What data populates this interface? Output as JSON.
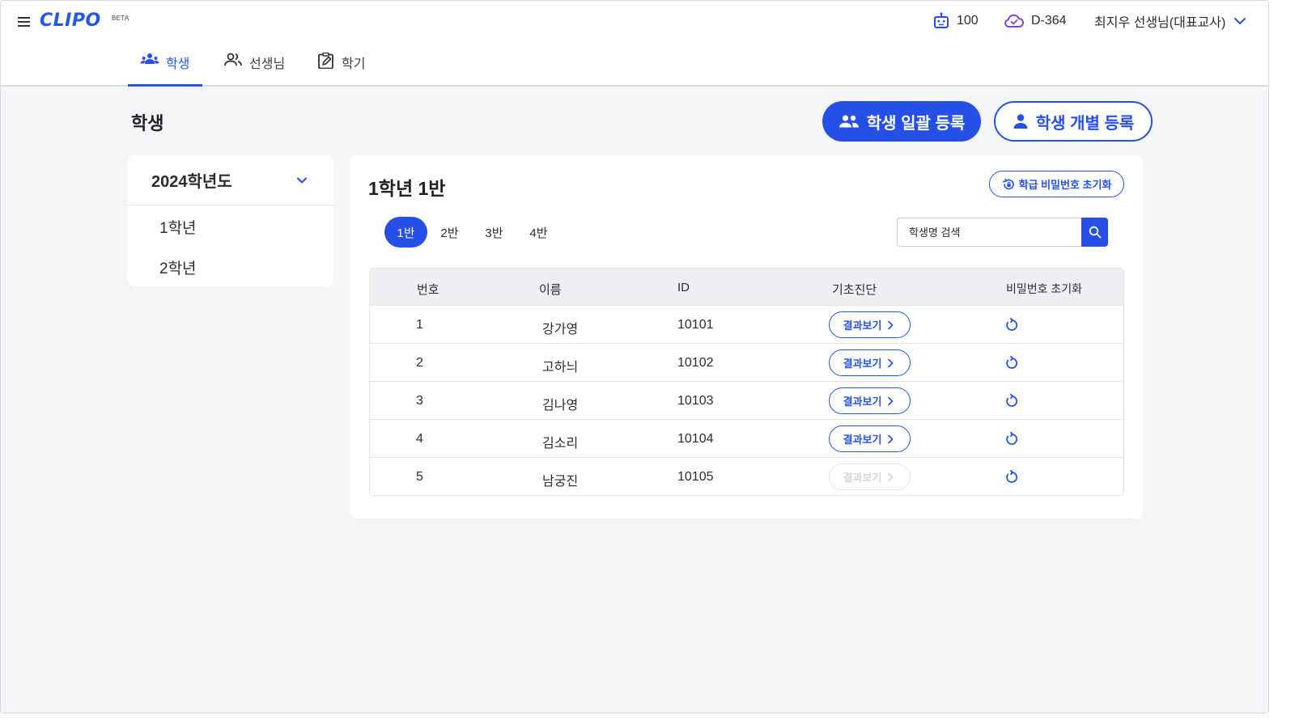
{
  "header": {
    "logo": "CLIPO",
    "logo_badge": "BETA",
    "credits": "100",
    "dday": "D-364",
    "user": "최지우 선생님(대표교사)"
  },
  "tabs": [
    {
      "label": "학생",
      "active": true
    },
    {
      "label": "선생님",
      "active": false
    },
    {
      "label": "학기",
      "active": false
    }
  ],
  "page": {
    "title": "학생",
    "bulk_button": "학생 일괄 등록",
    "single_button": "학생 개별 등록"
  },
  "sidebar": {
    "year": "2024학년도",
    "grades": [
      "1학년",
      "2학년"
    ]
  },
  "panel": {
    "title": "1학년 1반",
    "reset_button": "학급 비밀번호 초기화",
    "class_tabs": [
      {
        "label": "1반",
        "active": true
      },
      {
        "label": "2반",
        "active": false
      },
      {
        "label": "3반",
        "active": false
      },
      {
        "label": "4반",
        "active": false
      }
    ],
    "search_placeholder": "학생명 검색"
  },
  "table": {
    "columns": [
      "번호",
      "이름",
      "ID",
      "기초진단",
      "비밀번호 초기화"
    ],
    "result_label": "결과보기",
    "rows": [
      {
        "no": "1",
        "name": "강가영",
        "id": "10101",
        "result_enabled": true
      },
      {
        "no": "2",
        "name": "고하늬",
        "id": "10102",
        "result_enabled": true
      },
      {
        "no": "3",
        "name": "김나영",
        "id": "10103",
        "result_enabled": true
      },
      {
        "no": "4",
        "name": "김소리",
        "id": "10104",
        "result_enabled": true
      },
      {
        "no": "5",
        "name": "남궁진",
        "id": "10105",
        "result_enabled": false
      }
    ]
  },
  "colors": {
    "accent": "#2550e8",
    "background": "#f4f5f7",
    "disabled": "#d3d6dc"
  },
  "icons": {
    "menu": "hamburger-icon",
    "credits": "robot-icon",
    "dday": "cloud-icon",
    "user_menu": "chevron-down-icon",
    "tab_students": "students-icon",
    "tab_teachers": "teachers-icon",
    "tab_semester": "clipboard-edit-icon",
    "bulk": "group-icon",
    "single": "person-icon",
    "reset_class": "lock-reset-icon",
    "search": "search-icon",
    "result_arrow": "chevron-right-icon",
    "password_reset": "refresh-icon"
  }
}
